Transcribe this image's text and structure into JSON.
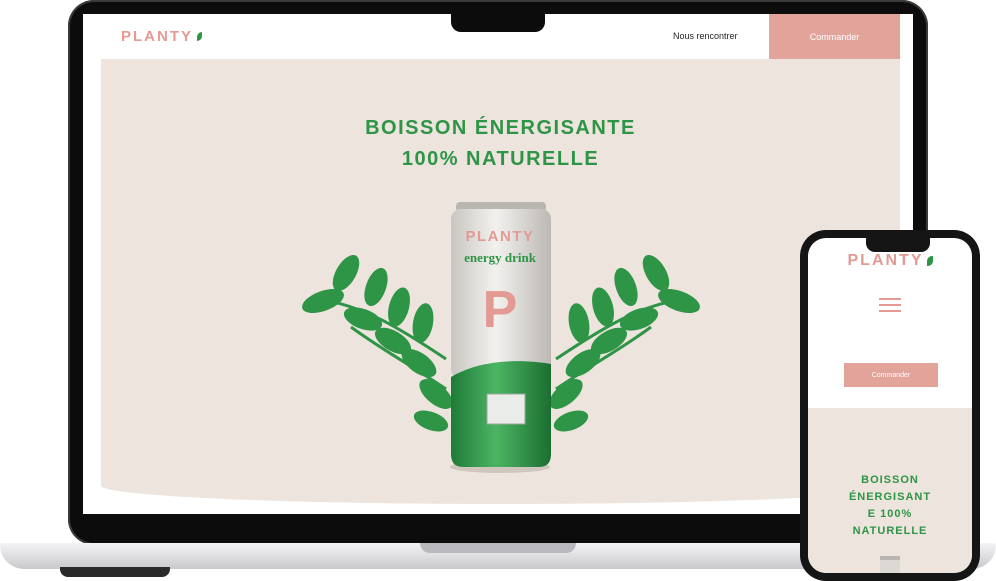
{
  "brand": {
    "name": "PLANTY",
    "color": "#e29a93",
    "leaf_color": "#2e9446"
  },
  "desktop": {
    "nav_link": "Nous rencontrer",
    "order_button": "Commander",
    "hero_title_line1": "BOISSON ÉNERGISANTE",
    "hero_title_line2": "100% NATURELLE",
    "hero_background": "#ece4dd"
  },
  "can": {
    "brand": "PLANTY",
    "subtitle": "energy drink",
    "letter": "P",
    "top_color": "#e3e0dc",
    "bottom_color": "#2e9446"
  },
  "mobile": {
    "logo": "PLANTY",
    "menu_icon": "hamburger-menu-icon",
    "order_button": "Commander",
    "hero_title_lines": [
      "BOISSON",
      "ÉNERGISANT",
      "E 100%",
      "NATURELLE"
    ]
  },
  "colors": {
    "accent_green": "#2e9446",
    "accent_pink": "#e1a39a",
    "cream": "#ece4dd"
  }
}
